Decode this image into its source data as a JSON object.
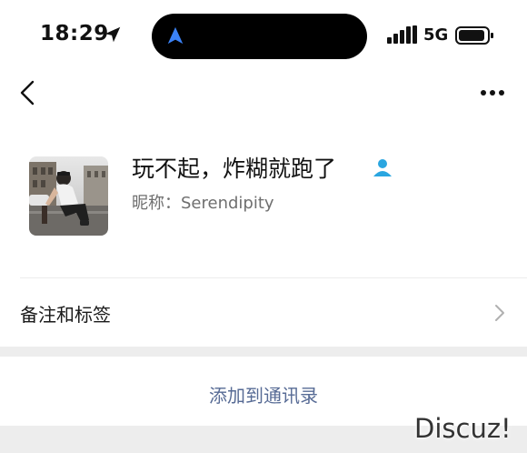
{
  "status_bar": {
    "time": "18:29",
    "network": "5G"
  },
  "profile": {
    "display_name": "玩不起，炸糊就跑了",
    "nickname": "昵称：Serendipity"
  },
  "menu": {
    "remark_label": "备注和标签",
    "add_contact_label": "添加到通讯录"
  },
  "watermark": "Discuz!",
  "colors": {
    "link": "#576b95",
    "verified_icon": "#2aa6e0",
    "separator": "#ededed"
  },
  "icons": {
    "back": "chevron-left",
    "more": "ellipsis",
    "remark": "chevron-right"
  }
}
